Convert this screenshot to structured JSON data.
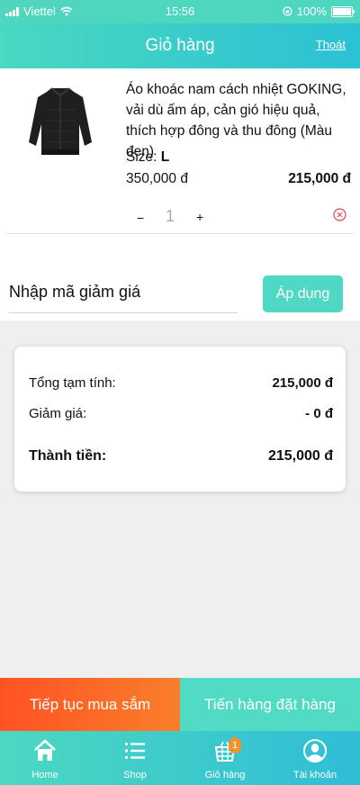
{
  "status_bar": {
    "carrier": "Viettel",
    "time": "15:56",
    "battery": "100%"
  },
  "header": {
    "title": "Giỏ hàng",
    "logout_label": "Thoát"
  },
  "cart": {
    "items": [
      {
        "name": "Áo khoác nam cách nhiệt GOKING, vải dù ấm áp, cản gió hiệu quả, thích hợp đông và thu đông (Màu đen)",
        "size_label": "Size:",
        "size_value": "L",
        "unit_price": "350,000 đ",
        "line_total": "215,000 đ",
        "qty_minus": "−",
        "quantity": "1",
        "qty_plus": "+"
      }
    ]
  },
  "voucher": {
    "placeholder": "Nhập mã giảm giá",
    "apply_label": "Áp dụng"
  },
  "summary": {
    "subtotal_label": "Tổng tạm tính:",
    "subtotal_value": "215,000 đ",
    "discount_label": "Giảm giá:",
    "discount_value": "- 0 đ",
    "total_label": "Thành tiền:",
    "total_value": "215,000 đ"
  },
  "actions": {
    "continue_label": "Tiếp tục mua sắm",
    "order_label": "Tiến hàng đặt hàng"
  },
  "tabbar": {
    "tabs": [
      {
        "label": "Home",
        "icon": "home-icon"
      },
      {
        "label": "Shop",
        "icon": "list-icon"
      },
      {
        "label": "Giỏ hàng",
        "icon": "cart-icon",
        "badge": "1"
      },
      {
        "label": "Tài khoản",
        "icon": "user-icon"
      }
    ]
  },
  "colors": {
    "accent": "#4fd8c4",
    "continue_button": "#ff5a25",
    "remove_icon": "#e0484d",
    "badge": "#f0922e"
  }
}
